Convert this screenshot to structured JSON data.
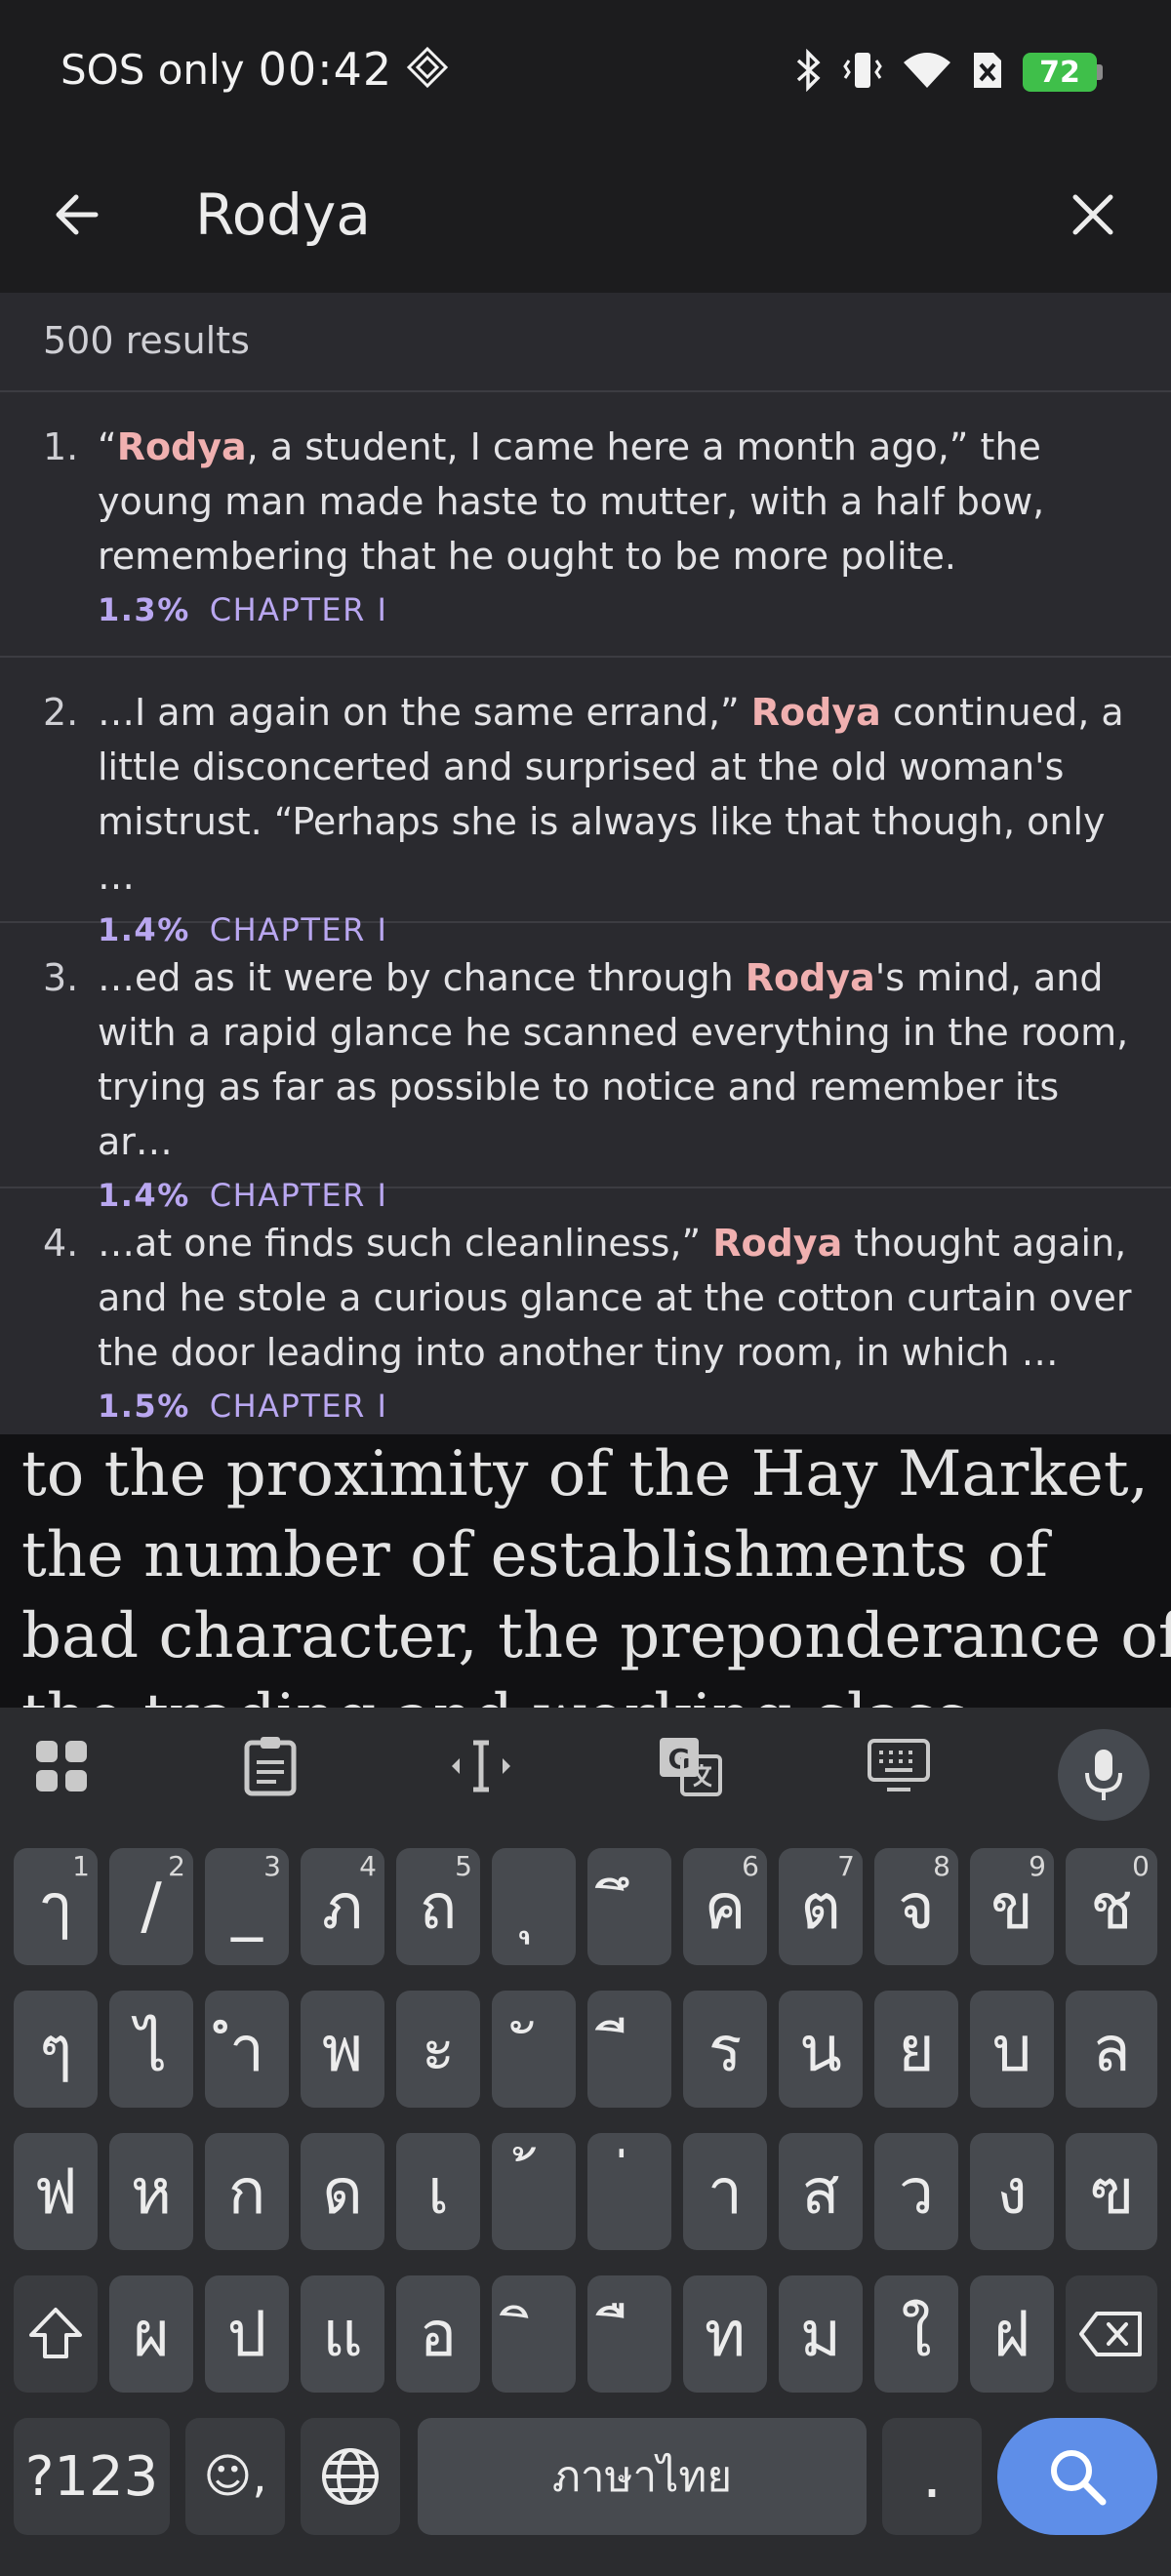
{
  "status_bar": {
    "carrier": "SOS only",
    "time": "00:42",
    "battery": "72"
  },
  "search": {
    "query": "Rodya",
    "results_count": "500 results"
  },
  "results": [
    {
      "number": "1.",
      "before": "“",
      "highlight": "Rodya",
      "after": ", a student, I came here a month ago,” the young man made haste to mutter, with a half bow, remembering that he ought to be more polite.",
      "percent": "1.3%",
      "chapter": "CHAPTER I"
    },
    {
      "number": "2.",
      "before": "…I am again on the same errand,” ",
      "highlight": "Rodya",
      "after": " continued, a little disconcerted and surprised at the old woman's mistrust. “Perhaps she is always like that though, only …",
      "percent": "1.4%",
      "chapter": "CHAPTER I"
    },
    {
      "number": "3.",
      "before": "…ed as it were by chance through ",
      "highlight": "Rodya",
      "after": "'s mind, and with a rapid glance he scanned everything in the room, trying as far as possible to notice and remember its ar…",
      "percent": "1.4%",
      "chapter": "CHAPTER I"
    },
    {
      "number": "4.",
      "before": "…at one finds such cleanliness,” ",
      "highlight": "Rodya",
      "after": " thought again, and he stole a curious glance at the cotton curtain over the door leading into another tiny room, in which …",
      "percent": "1.5%",
      "chapter": "CHAPTER I"
    }
  ],
  "reader_lines": [
    "to the proximity of the Hay Market,",
    "the number of establishments of",
    "bad character, the preponderance of",
    "the trading and working class"
  ],
  "keyboard": {
    "row1": [
      {
        "label": "ๅ",
        "hint": "1"
      },
      {
        "label": "/",
        "hint": "2"
      },
      {
        "label": "_",
        "hint": "3"
      },
      {
        "label": "ภ",
        "hint": "4"
      },
      {
        "label": "ถ",
        "hint": "5"
      },
      {
        "label": "ุ",
        "hint": ""
      },
      {
        "label": "ึ",
        "hint": ""
      },
      {
        "label": "ค",
        "hint": "6"
      },
      {
        "label": "ต",
        "hint": "7"
      },
      {
        "label": "จ",
        "hint": "8"
      },
      {
        "label": "ข",
        "hint": "9"
      },
      {
        "label": "ช",
        "hint": "0"
      }
    ],
    "row2": [
      "ๆ",
      "ไ",
      "ำ",
      "พ",
      "ะ",
      "ั",
      "ี",
      "ร",
      "น",
      "ย",
      "บ",
      "ล"
    ],
    "row3": [
      "ฟ",
      "ห",
      "ก",
      "ด",
      "เ",
      "้",
      "่",
      "า",
      "ส",
      "ว",
      "ง",
      "ฃ"
    ],
    "row4": [
      "ผ",
      "ป",
      "แ",
      "อ",
      "ิ",
      "ื",
      "ท",
      "ม",
      "ใ",
      "ฝ"
    ],
    "symbols_label": "?123",
    "emoji_comma": "☺,",
    "space_label": "ภาษาไทย",
    "period": "."
  },
  "colors": {
    "highlight": "#f0b0b0",
    "meta": "#b9a7f0",
    "search_key": "#5e8ee8",
    "battery": "#3fbf4a"
  }
}
